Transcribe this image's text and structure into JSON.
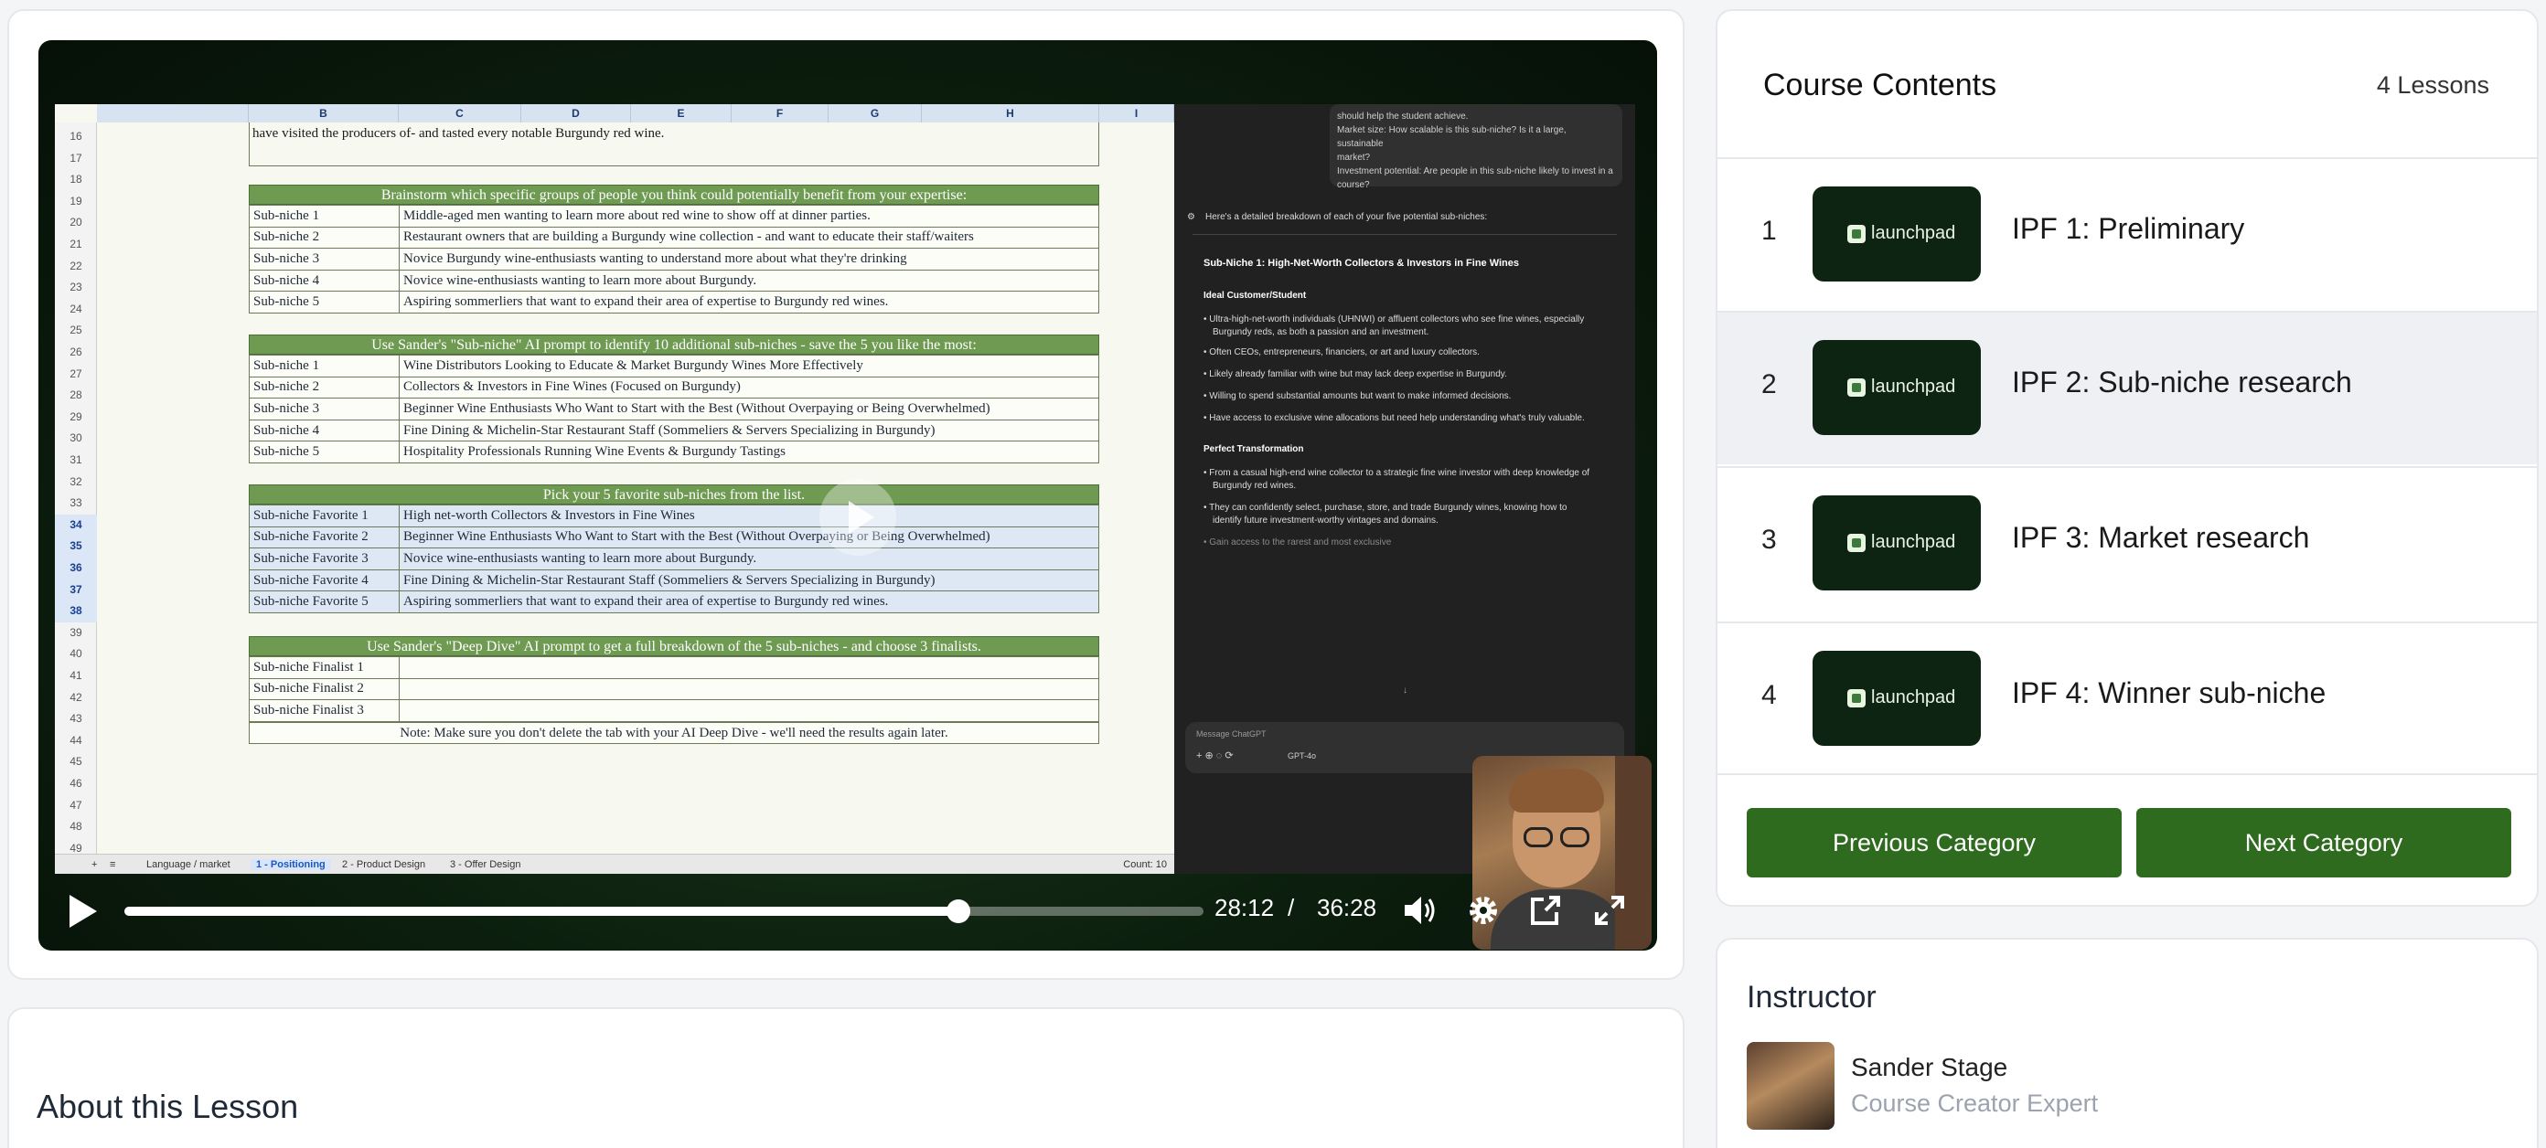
{
  "video": {
    "current_time": "28:12",
    "separator": "/",
    "duration": "36:28",
    "progress": 0.773
  },
  "spreadsheet": {
    "columns": [
      "B",
      "C",
      "D",
      "E",
      "F",
      "G",
      "H",
      "I"
    ],
    "row_numbers": [
      "16",
      "17",
      "18",
      "19",
      "20",
      "21",
      "22",
      "23",
      "24",
      "25",
      "26",
      "27",
      "28",
      "29",
      "30",
      "31",
      "32",
      "33",
      "34",
      "35",
      "36",
      "37",
      "38",
      "39",
      "40",
      "41",
      "42",
      "43",
      "44",
      "45",
      "46",
      "47",
      "48",
      "49"
    ],
    "intro_line": "have visited the producers of- and tasted every notable Burgundy red wine.",
    "section1": {
      "header": "Brainstorm which specific groups of people you think could potentially benefit from your expertise:",
      "rows": [
        {
          "label": "Sub-niche 1",
          "value": "Middle-aged men wanting to learn more about red wine to show off at dinner parties."
        },
        {
          "label": "Sub-niche 2",
          "value": "Restaurant owners that are building a Burgundy wine collection - and want to educate their staff/waiters"
        },
        {
          "label": "Sub-niche 3",
          "value": "Novice Burgundy wine-enthusiasts wanting to understand more about what they're drinking"
        },
        {
          "label": "Sub-niche 4",
          "value": "Novice wine-enthusiasts wanting to learn more about Burgundy."
        },
        {
          "label": "Sub-niche 5",
          "value": "Aspiring sommerliers that want to expand their area of expertise to Burgundy red wines."
        }
      ]
    },
    "section2": {
      "header": "Use Sander's \"Sub-niche\" AI prompt to identify 10 additional sub-niches - save the 5 you like the most:",
      "rows": [
        {
          "label": "Sub-niche 1",
          "value": "Wine Distributors Looking to Educate & Market Burgundy Wines More Effectively"
        },
        {
          "label": "Sub-niche 2",
          "value": "Collectors & Investors in Fine Wines (Focused on Burgundy)"
        },
        {
          "label": "Sub-niche 3",
          "value": "Beginner Wine Enthusiasts Who Want to Start with the Best (Without Overpaying or Being Overwhelmed)"
        },
        {
          "label": "Sub-niche 4",
          "value": "Fine Dining & Michelin-Star Restaurant Staff (Sommeliers & Servers Specializing in Burgundy)"
        },
        {
          "label": "Sub-niche 5",
          "value": "Hospitality Professionals Running Wine Events & Burgundy Tastings"
        }
      ]
    },
    "section3": {
      "header": "Pick your 5 favorite sub-niches from the list.",
      "rows": [
        {
          "label": "Sub-niche Favorite 1",
          "value": "High net-worth Collectors & Investors in Fine Wines"
        },
        {
          "label": "Sub-niche Favorite 2",
          "value": "Beginner Wine Enthusiasts Who Want to Start with the Best (Without Overpaying or Being Overwhelmed)"
        },
        {
          "label": "Sub-niche Favorite 3",
          "value": "Novice wine-enthusiasts wanting to learn more about Burgundy."
        },
        {
          "label": "Sub-niche Favorite 4",
          "value": "Fine Dining & Michelin-Star Restaurant Staff (Sommeliers & Servers Specializing in Burgundy)"
        },
        {
          "label": "Sub-niche Favorite 5",
          "value": "Aspiring sommerliers that want to expand their area of expertise to Burgundy red wines."
        }
      ]
    },
    "section4": {
      "header": "Use Sander's \"Deep Dive\" AI prompt to get a full breakdown of the 5 sub-niches - and choose 3 finalists.",
      "rows": [
        {
          "label": "Sub-niche Finalist 1",
          "value": ""
        },
        {
          "label": "Sub-niche Finalist 2",
          "value": ""
        },
        {
          "label": "Sub-niche Finalist 3",
          "value": ""
        }
      ]
    },
    "note": "Note: Make sure you don't delete the tab with your AI Deep Dive - we'll need the results again later.",
    "tabs": [
      "Language / market",
      "1 - Positioning",
      "2 - Product Design",
      "3 - Offer Design"
    ],
    "count": "Count: 10"
  },
  "chat": {
    "bubble_lines": [
      "should help the student achieve.",
      "Market size: How scalable is this sub-niche? Is it a large, sustainable",
      "market?",
      "Investment potential: Are people in this sub-niche likely to invest in a",
      "course?"
    ],
    "intro": "Here's a detailed breakdown of each of your five potential sub-niches:",
    "heading": "Sub-Niche 1: High-Net-Worth Collectors & Investors in Fine Wines",
    "subheading1": "Ideal Customer/Student",
    "bullets1": [
      "Ultra-high-net-worth individuals (UHNWI) or affluent collectors who see fine wines, especially",
      "Burgundy reds, as both a passion and an investment.",
      "Often CEOs, entrepreneurs, financiers, or art and luxury collectors.",
      "Likely already familiar with wine but may lack deep expertise in Burgundy.",
      "Willing to spend substantial amounts but want to make informed decisions.",
      "Have access to exclusive wine allocations but need help understanding what's truly valuable."
    ],
    "subheading2": "Perfect Transformation",
    "bullets2": [
      "From a casual high-end wine collector to a strategic fine wine investor with deep knowledge of",
      "Burgundy red wines.",
      "They can confidently select, purchase, store, and trade Burgundy wines, knowing how to",
      "identify future investment-worthy vintages and domains.",
      "Gain access to the rarest and most exclusive"
    ],
    "input_placeholder": "Message ChatGPT",
    "model": "GPT-4o"
  },
  "course": {
    "title": "Course Contents",
    "count": "4 Lessons",
    "thumb_logo": "launchpad",
    "lessons": [
      {
        "num": "1",
        "title": "IPF 1: Preliminary"
      },
      {
        "num": "2",
        "title": "IPF 2: Sub-niche research"
      },
      {
        "num": "3",
        "title": "IPF 3: Market research"
      },
      {
        "num": "4",
        "title": "IPF 4: Winner sub-niche"
      }
    ],
    "prev_label": "Previous Category",
    "next_label": "Next Category"
  },
  "about": {
    "title": "About this Lesson"
  },
  "instructor": {
    "title": "Instructor",
    "name": "Sander Stage",
    "role": "Course Creator Expert"
  },
  "colors": {
    "accent_green": "#2e6b1e",
    "thumb_bg": "#0e2412",
    "sheet_header_green": "#6f9a52"
  }
}
